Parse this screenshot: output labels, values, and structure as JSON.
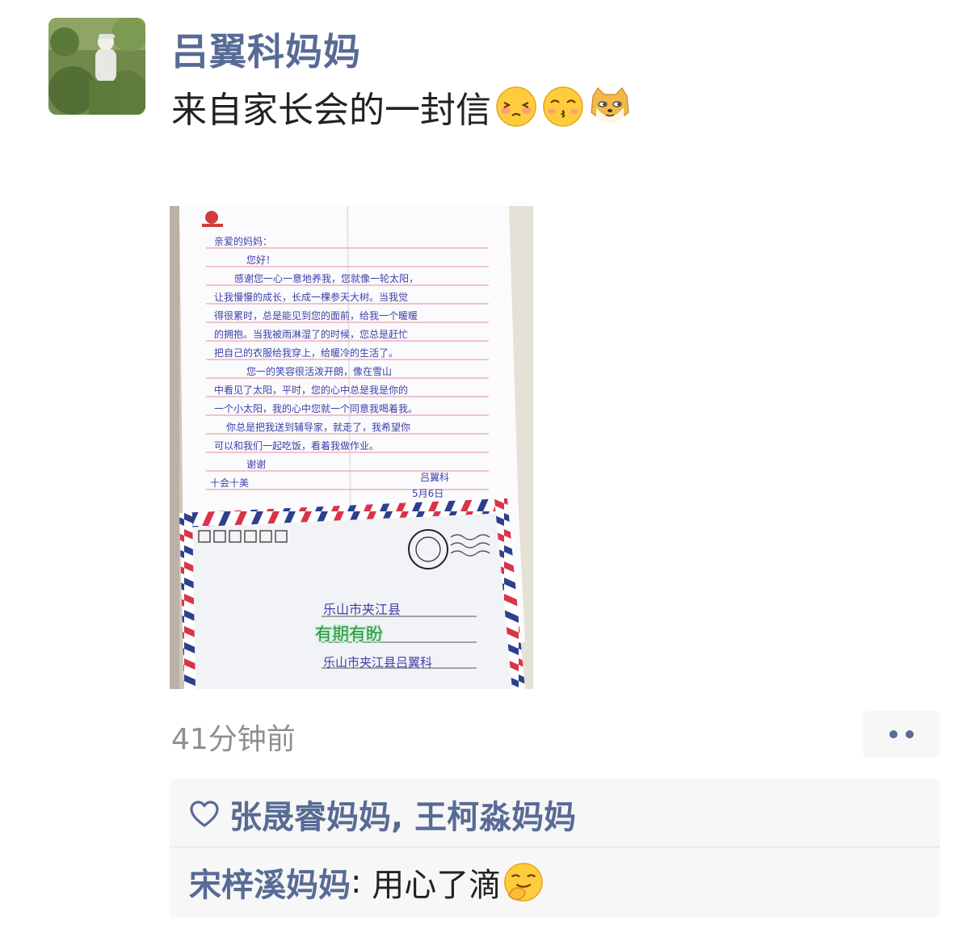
{
  "post": {
    "author": "吕翼科妈妈",
    "text": "来自家长会的一封信",
    "emojis": [
      "shy-face-emoji",
      "kiss-face-emoji",
      "doge-emoji"
    ],
    "time": "41分钟前"
  },
  "photo": {
    "letter_lines": [
      "亲爱的妈妈：",
      "您好！",
      "感谢您一心一意地养我，您就像一轮太阳，",
      "让我慢慢的成长，长成一棵参天大树。当我觉",
      "得很累时，总是能见到您的面前，给我一个暖暖",
      "的拥抱。当我被雨淋湿了的时候，您总是赶忙",
      "把自己的衣服给我穿上，给暖冷的生活了。",
      "您一的笑容很活泼开朗，像在雪山",
      "中看见了太阳，平时，您的心中总是我是你的",
      "一个小太阳，我的心中您就一个同意我喝着我。",
      "你总是把我送到辅导家，就走了，我希望你",
      "可以和我们一起吃饭，看着我做作业。",
      "谢谢",
      "十会十美"
    ],
    "signature": "吕翼科",
    "date": "5月6日",
    "address_line1": "乐山市夹江县",
    "sticker": "有期有盼",
    "address_line2": "乐山市夹江县吕翼科"
  },
  "likes": {
    "names": "张晟睿妈妈, 王柯淼妈妈"
  },
  "comments": [
    {
      "author": "宋梓溪妈妈",
      "separator": ": ",
      "text": "用心了滴",
      "emoji": "smirk-face-emoji"
    }
  ],
  "colors": {
    "name_blue": "#576b95",
    "text": "#222222",
    "time_gray": "#8f8f8f",
    "panel_bg": "#f7f7f7"
  }
}
